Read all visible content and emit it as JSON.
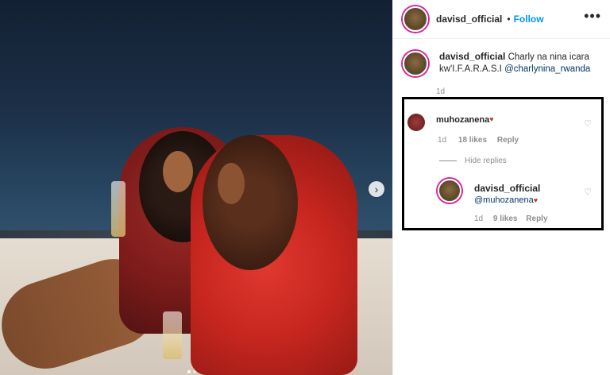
{
  "post": {
    "username": "davisd_official",
    "follow_label": "Follow",
    "separator": "•",
    "more_label": "•••"
  },
  "caption": {
    "username": "davisd_official",
    "text_line1": "Charly na nina icara",
    "text_line2": "kw'I.F.A.R.A.S.I",
    "mention": "@charlynina_rwanda",
    "time": "1d"
  },
  "comment": {
    "username": "muhozanena",
    "heart": "♥",
    "time": "1d",
    "likes": "18 likes",
    "reply_label": "Reply",
    "hide_replies": "Hide replies"
  },
  "reply": {
    "username": "davisd_official",
    "mention": "@muhozanena",
    "heart": "♥",
    "time": "1d",
    "likes": "9 likes",
    "reply_label": "Reply"
  },
  "icons": {
    "like": "♡",
    "next": "›"
  },
  "colors": {
    "accent": "#0095f6",
    "text": "#262626",
    "muted": "#8e8e8e"
  }
}
